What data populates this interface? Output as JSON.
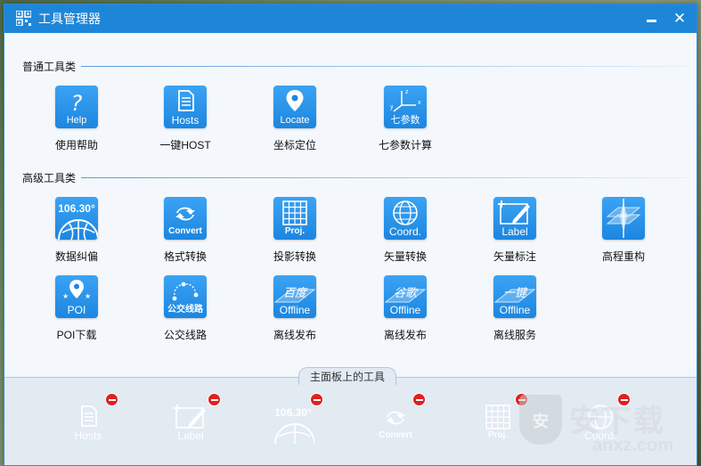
{
  "window": {
    "title": "工具管理器"
  },
  "sections": {
    "general": "普通工具类",
    "advanced": "高级工具类"
  },
  "general_tools": [
    {
      "caption": "Help",
      "label": "使用帮助",
      "icon": "help-icon"
    },
    {
      "caption": "Hosts",
      "label": "一键HOST",
      "icon": "hosts-file-icon"
    },
    {
      "caption": "Locate",
      "label": "坐标定位",
      "icon": "location-pin-icon"
    },
    {
      "caption": "七参数",
      "label": "七参数计算",
      "icon": "xyz-axes-icon"
    }
  ],
  "advanced_tools_row1": [
    {
      "caption": "106.30°",
      "label": "数据纠偏",
      "icon": "globe-coordinate-icon"
    },
    {
      "caption": "Convert",
      "label": "格式转换",
      "icon": "convert-arrows-icon"
    },
    {
      "caption": "Proj.",
      "label": "投影转换",
      "icon": "projection-grid-icon"
    },
    {
      "caption": "Coord.",
      "label": "矢量转换",
      "icon": "globe-icon"
    },
    {
      "caption": "Label",
      "label": "矢量标注",
      "icon": "label-pencil-icon"
    },
    {
      "caption": "",
      "label": "高程重构",
      "icon": "elevation-layers-icon"
    }
  ],
  "advanced_tools_row2": [
    {
      "caption": "POI",
      "label": "POI下载",
      "icon": "poi-pin-icon"
    },
    {
      "caption": "公交线路",
      "label": "公交线路",
      "icon": "bus-route-icon"
    },
    {
      "caption": "Offline",
      "label": "离线发布",
      "badge": "百度",
      "icon": "offline-baidu-icon"
    },
    {
      "caption": "Offline",
      "label": "离线发布",
      "badge": "谷歌",
      "icon": "offline-google-icon"
    },
    {
      "caption": "Offline",
      "label": "离线服务",
      "badge": "一键",
      "icon": "offline-service-icon"
    }
  ],
  "panel": {
    "title": "主面板上的工具",
    "pinned": [
      {
        "caption": "Hosts",
        "icon": "hosts-file-icon"
      },
      {
        "caption": "Label",
        "icon": "label-pencil-icon"
      },
      {
        "caption": "106.30°",
        "icon": "globe-coordinate-icon"
      },
      {
        "caption": "Convert",
        "icon": "convert-arrows-icon"
      },
      {
        "caption": "Proj.",
        "icon": "projection-grid-icon"
      },
      {
        "caption": "Coord.",
        "icon": "globe-icon"
      }
    ]
  },
  "watermark": {
    "shield_char": "安",
    "text": "安下载",
    "sub": "anxz.com"
  }
}
